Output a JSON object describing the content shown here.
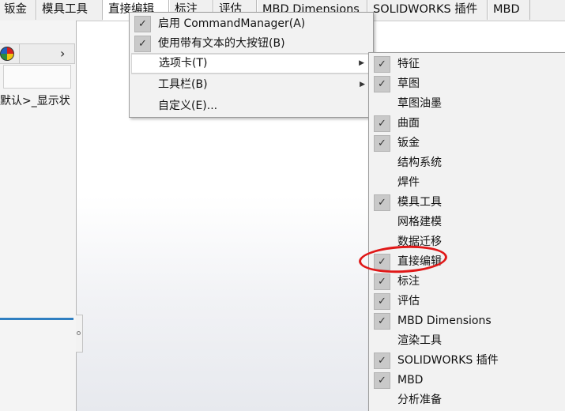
{
  "tabs": [
    "钣金",
    "模具工具",
    "直接编辑",
    "标注",
    "评估",
    "MBD Dimensions",
    "SOLIDWORKS 插件",
    "MBD"
  ],
  "active_tab": "直接编辑",
  "left_panel": {
    "tree_text": "默认>_显示状",
    "chevron": "›",
    "appearance_icon": "appearance-icon"
  },
  "menu_main": {
    "items": [
      {
        "label": "启用 CommandManager(A)",
        "checked": true,
        "submenu": false
      },
      {
        "label": "使用带有文本的大按钮(B)",
        "checked": true,
        "submenu": false
      },
      {
        "label": "选项卡(T)",
        "checked": false,
        "submenu": true
      },
      {
        "label": "工具栏(B)",
        "checked": false,
        "submenu": true
      },
      {
        "label": "自定义(E)...",
        "checked": false,
        "submenu": false
      }
    ]
  },
  "menu_tabs": {
    "items": [
      {
        "label": "特征",
        "checked": true
      },
      {
        "label": "草图",
        "checked": true
      },
      {
        "label": "草图油墨",
        "checked": false
      },
      {
        "label": "曲面",
        "checked": true
      },
      {
        "label": "钣金",
        "checked": true
      },
      {
        "label": "结构系统",
        "checked": false
      },
      {
        "label": "焊件",
        "checked": false
      },
      {
        "label": "模具工具",
        "checked": true
      },
      {
        "label": "网格建模",
        "checked": false
      },
      {
        "label": "数据迁移",
        "checked": false
      },
      {
        "label": "直接编辑",
        "checked": true
      },
      {
        "label": "标注",
        "checked": true
      },
      {
        "label": "评估",
        "checked": true
      },
      {
        "label": "MBD Dimensions",
        "checked": true
      },
      {
        "label": "渲染工具",
        "checked": false
      },
      {
        "label": "SOLIDWORKS 插件",
        "checked": true
      },
      {
        "label": "MBD",
        "checked": true
      },
      {
        "label": "分析准备",
        "checked": false
      }
    ]
  },
  "glyphs": {
    "check": "✓",
    "arrow": "▶"
  },
  "colors": {
    "annotation": "#e01818",
    "check_bg": "#c9c9c9",
    "blue_bar": "#2f7fc1"
  }
}
